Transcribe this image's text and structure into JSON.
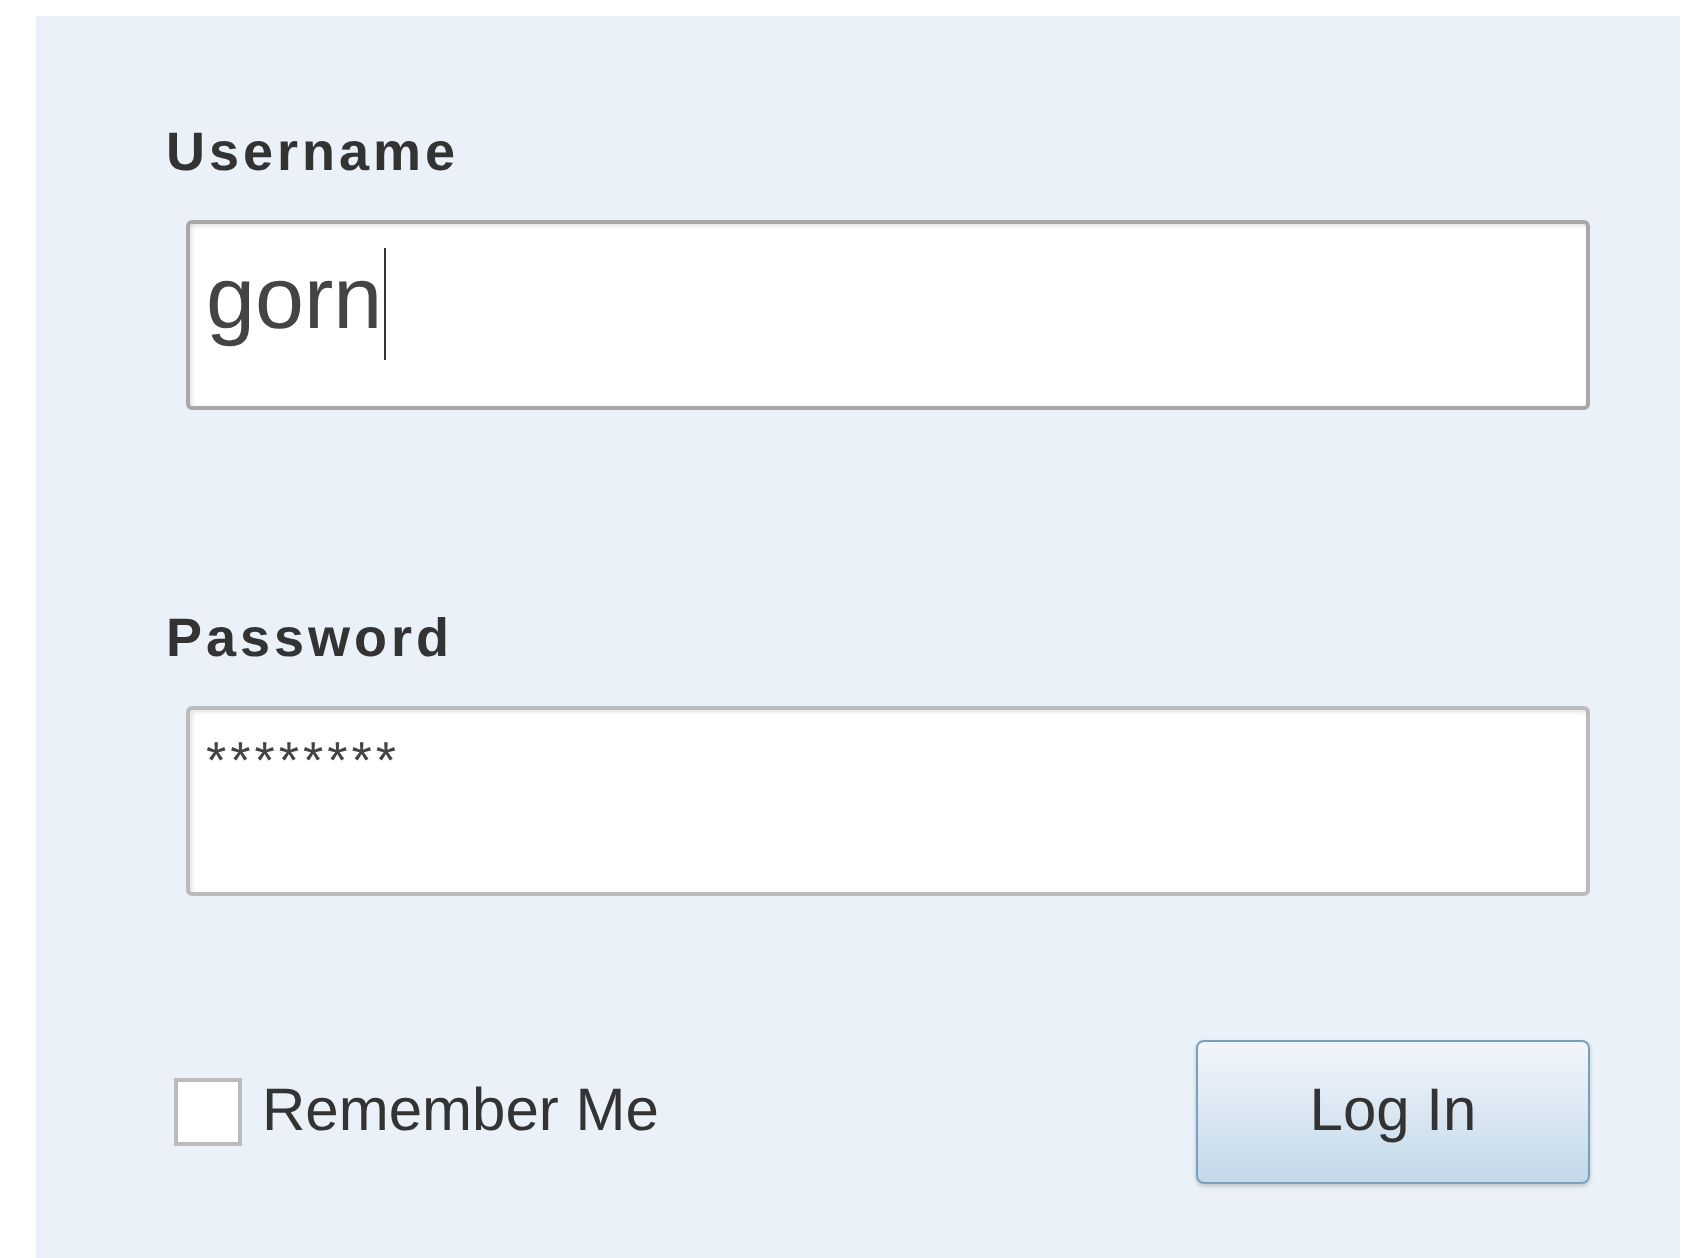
{
  "fields": [
    {
      "label": "Username",
      "value": "gorn",
      "kind": "text",
      "focused": true
    },
    {
      "label": "Password",
      "value": "********",
      "kind": "password",
      "focused": false
    }
  ],
  "remember": {
    "label": "Remember Me",
    "checked": false
  },
  "button": {
    "label": "Log In"
  }
}
